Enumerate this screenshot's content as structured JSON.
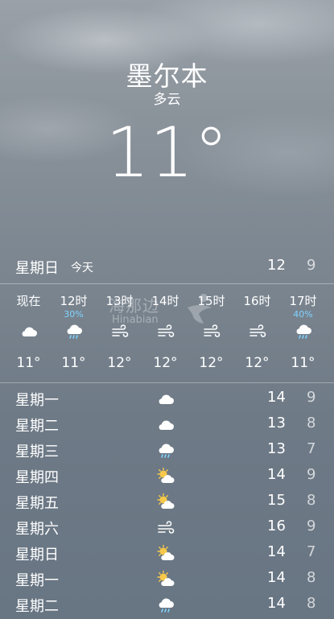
{
  "header": {
    "city": "墨尔本",
    "condition": "多云",
    "temperature": "11°"
  },
  "today": {
    "day": "星期日",
    "tag": "今天",
    "high": "12",
    "low": "9"
  },
  "hourly": [
    {
      "time": "现在",
      "pct": "",
      "icon": "cloud-icon",
      "temp": "11°"
    },
    {
      "time": "12时",
      "pct": "30%",
      "icon": "rain-icon",
      "temp": "11°"
    },
    {
      "time": "13时",
      "pct": "",
      "icon": "wind-icon",
      "temp": "12°"
    },
    {
      "time": "14时",
      "pct": "",
      "icon": "wind-icon",
      "temp": "12°"
    },
    {
      "time": "15时",
      "pct": "",
      "icon": "wind-icon",
      "temp": "12°"
    },
    {
      "time": "16时",
      "pct": "",
      "icon": "wind-icon",
      "temp": "12°"
    },
    {
      "time": "17时",
      "pct": "40%",
      "icon": "rain-icon",
      "temp": "11°"
    }
  ],
  "daily": [
    {
      "day": "星期一",
      "icon": "cloud-icon",
      "high": "14",
      "low": "9"
    },
    {
      "day": "星期二",
      "icon": "cloud-icon",
      "high": "13",
      "low": "8"
    },
    {
      "day": "星期三",
      "icon": "rain-icon",
      "high": "13",
      "low": "7"
    },
    {
      "day": "星期四",
      "icon": "partly-sunny-icon",
      "high": "14",
      "low": "9"
    },
    {
      "day": "星期五",
      "icon": "partly-sunny-icon",
      "high": "15",
      "low": "8"
    },
    {
      "day": "星期六",
      "icon": "wind-icon",
      "high": "16",
      "low": "9"
    },
    {
      "day": "星期日",
      "icon": "partly-sunny-icon",
      "high": "14",
      "low": "7"
    },
    {
      "day": "星期一",
      "icon": "partly-sunny-icon",
      "high": "14",
      "low": "8"
    },
    {
      "day": "星期二",
      "icon": "rain-icon",
      "high": "14",
      "low": "8"
    }
  ],
  "watermark": {
    "line1": "海那边",
    "line2": "Hinabian"
  },
  "colors": {
    "precip": "#7fd3ff",
    "sun": "#f6c94a"
  }
}
